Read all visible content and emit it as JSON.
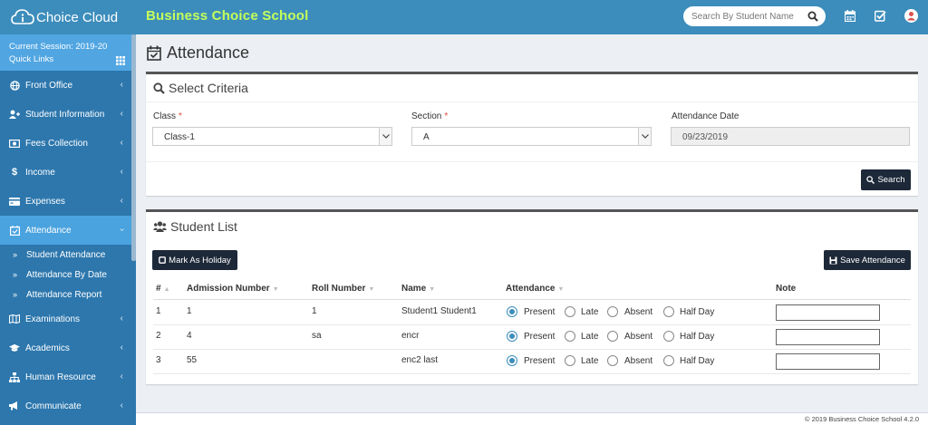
{
  "app": {
    "logo_text": "Choice Cloud",
    "school_name": "Business Choice School",
    "search_placeholder": "Search By Student Name"
  },
  "sidebar": {
    "session": "Current Session: 2019-20",
    "quick_links": "Quick Links",
    "items": [
      {
        "label": "Front Office",
        "icon": "globe-icon"
      },
      {
        "label": "Student Information",
        "icon": "user-plus-icon"
      },
      {
        "label": "Fees Collection",
        "icon": "money-icon"
      },
      {
        "label": "Income",
        "icon": "dollar-icon"
      },
      {
        "label": "Expenses",
        "icon": "credit-card-icon"
      },
      {
        "label": "Attendance",
        "icon": "calendar-check-icon"
      },
      {
        "label": "Examinations",
        "icon": "map-icon"
      },
      {
        "label": "Academics",
        "icon": "graduation-cap-icon"
      },
      {
        "label": "Human Resource",
        "icon": "sitemap-icon"
      },
      {
        "label": "Communicate",
        "icon": "bullhorn-icon"
      }
    ],
    "subitems": [
      "Student Attendance",
      "Attendance By Date",
      "Attendance Report"
    ]
  },
  "page": {
    "title": "Attendance"
  },
  "criteria": {
    "header": "Select Criteria",
    "class_label": "Class",
    "class_value": "Class-1",
    "section_label": "Section",
    "section_value": "A",
    "date_label": "Attendance Date",
    "date_value": "09/23/2019",
    "search_button": "Search"
  },
  "student_list": {
    "header": "Student List",
    "holiday_button": "Mark As Holiday",
    "save_button": "Save Attendance",
    "columns": [
      "#",
      "Admission Number",
      "Roll Number",
      "Name",
      "Attendance",
      "Note"
    ],
    "options": [
      "Present",
      "Late",
      "Absent",
      "Half Day"
    ],
    "rows": [
      {
        "num": "1",
        "admission": "1",
        "roll": "1",
        "name": "Student1 Student1",
        "attendance": "Present",
        "note": ""
      },
      {
        "num": "2",
        "admission": "4",
        "roll": "sa",
        "name": "encr",
        "attendance": "Present",
        "note": ""
      },
      {
        "num": "3",
        "admission": "55",
        "roll": "",
        "name": "enc2 last",
        "attendance": "Present",
        "note": ""
      }
    ]
  },
  "footer": {
    "text": "© 2019 Business Choice School 4.2.0"
  }
}
